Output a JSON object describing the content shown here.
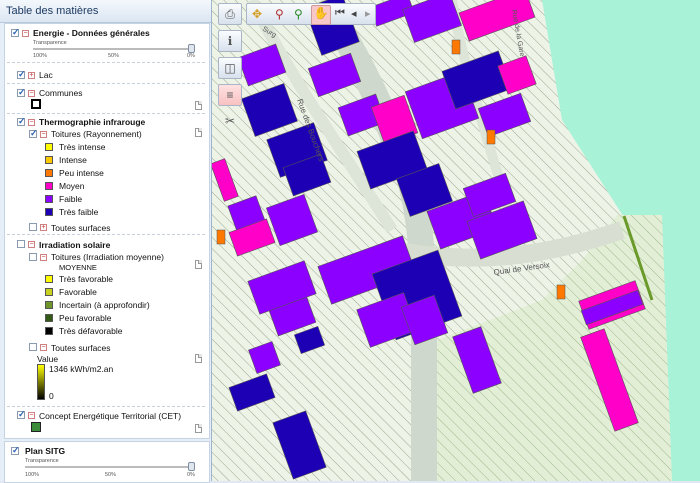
{
  "panel": {
    "title": "Table des matières"
  },
  "layers": {
    "energie": {
      "label": "Energie - Données générales",
      "transparency_label": "Transparence",
      "t100": "100%",
      "t50": "50%",
      "t0": "0%"
    },
    "lac": {
      "label": "Lac"
    },
    "communes": {
      "label": "Communes"
    },
    "thermo": {
      "label": "Thermographie infrarouge",
      "toitures": "Toitures (Rayonnement)",
      "classes": [
        {
          "label": "Très intense",
          "color": "#ffff00"
        },
        {
          "label": "Intense",
          "color": "#ffc800"
        },
        {
          "label": "Peu intense",
          "color": "#ff7800"
        },
        {
          "label": "Moyen",
          "color": "#ff00c8"
        },
        {
          "label": "Faible",
          "color": "#8c00ff"
        },
        {
          "label": "Très faible",
          "color": "#1e00b4"
        }
      ],
      "toutes": "Toutes surfaces"
    },
    "irradiation": {
      "label": "Irradiation solaire",
      "toitures": "Toitures (Irradiation moyenne)",
      "moyenne": "MOYENNE",
      "classes": [
        {
          "label": "Très favorable",
          "color": "#ffff00"
        },
        {
          "label": "Favorable",
          "color": "#c8d21e"
        },
        {
          "label": "Incertain (à approfondir)",
          "color": "#6e9628"
        },
        {
          "label": "Peu favorable",
          "color": "#325a14"
        },
        {
          "label": "Très défavorable",
          "color": "#000000"
        }
      ],
      "toutes": "Toutes surfaces",
      "value_label": "Value",
      "max": "1346 kWh/m2.an",
      "min": "0"
    },
    "cet": {
      "label": "Concept Energétique Territorial (CET)"
    },
    "sitg": {
      "label": "Plan SITG",
      "transparency_label": "Transparence",
      "t100": "100%",
      "t50": "50%",
      "t0": "0%"
    }
  },
  "map": {
    "street1": "Rue des Bouchers",
    "street2": "Quai de Versoix",
    "street3": "...gue",
    "street4": "Rue de la Gare",
    "street5": "Surg"
  },
  "toolbar": {
    "icons": [
      "printer-icon",
      "zoom-box-icon",
      "identify-icon",
      "pan-icon",
      "back-icon",
      "prev-icon",
      "next-icon",
      "info-icon",
      "measure-icon",
      "legend-icon",
      "tool-icon"
    ]
  }
}
